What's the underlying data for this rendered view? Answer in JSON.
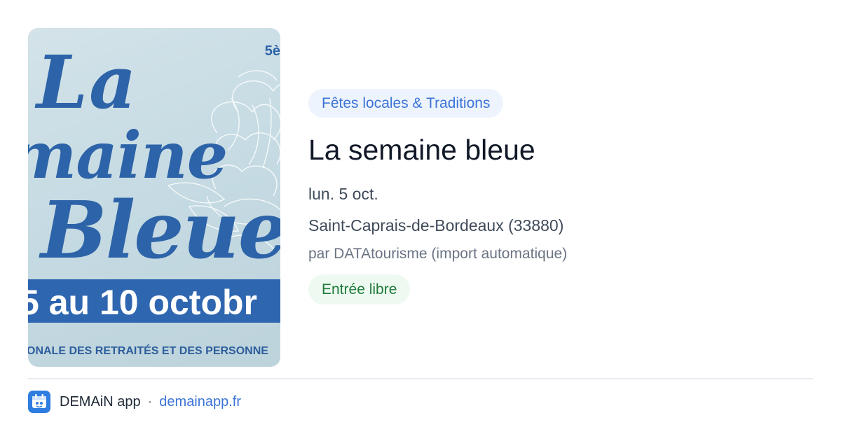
{
  "poster": {
    "edition": "5è",
    "line1": "La",
    "line2": "maine",
    "line3": "Bleue",
    "dates": "5 au 10 octobr",
    "footer_text": "ONALE DES RETRAITÉS ET DES PERSONNE"
  },
  "event": {
    "category": "Fêtes locales & Traditions",
    "title": "La semaine bleue",
    "date": "lun. 5 oct.",
    "location": "Saint-Caprais-de-Bordeaux (33880)",
    "source": "par DATAtourisme (import automatique)",
    "price": "Entrée libre"
  },
  "footer": {
    "app_icon": "demain-app-icon",
    "app_name": "DEMAiN app",
    "separator": "·",
    "link": "demainapp.fr"
  },
  "colors": {
    "category_bg": "#eef4fd",
    "category_text": "#3b74d6",
    "price_bg": "#eefaf1",
    "price_text": "#1f7a3a",
    "poster_blue": "#2f66b0"
  }
}
